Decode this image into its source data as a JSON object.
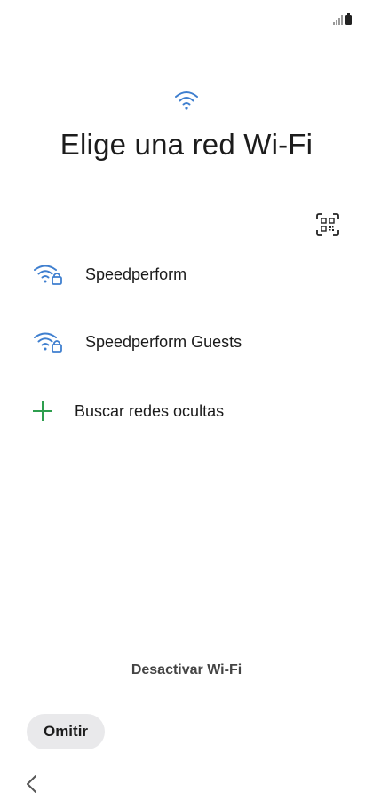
{
  "header": {
    "title": "Elige una red Wi-Fi"
  },
  "networks": [
    {
      "name": "Speedperform",
      "icon": "wifi-lock-icon",
      "secured": true
    },
    {
      "name": "Speedperform Guests",
      "icon": "wifi-lock-icon",
      "secured": true
    }
  ],
  "hidden_networks": {
    "label": "Buscar redes ocultas",
    "icon": "plus-icon"
  },
  "footer": {
    "disable_wifi_label": "Desactivar Wi-Fi",
    "skip_label": "Omitir"
  },
  "colors": {
    "wifi_accent": "#3f7fcf",
    "plus_accent": "#2e9e4e",
    "skip_bg": "#e9e9eb"
  }
}
